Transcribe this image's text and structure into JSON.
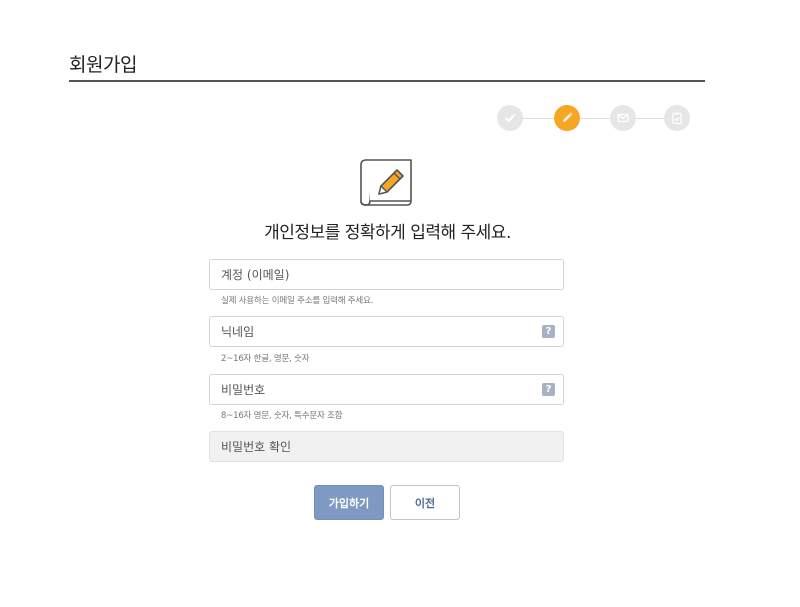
{
  "page": {
    "title": "회원가입",
    "heading": "개인정보를 정확하게 입력해 주세요."
  },
  "steps": [
    {
      "icon": "check-icon",
      "state": "done"
    },
    {
      "icon": "pencil-icon",
      "state": "active"
    },
    {
      "icon": "mail-icon",
      "state": "pending"
    },
    {
      "icon": "clipboard-icon",
      "state": "pending"
    }
  ],
  "form": {
    "email": {
      "placeholder": "계정 (이메일)",
      "hint": "실제 사용하는 이메일 주소를 입력해 주세요."
    },
    "nickname": {
      "placeholder": "닉네임",
      "hint": "2~16자 한글, 영문, 숫자",
      "help": "?"
    },
    "password": {
      "placeholder": "비밀번호",
      "hint": "8~16자 영문, 숫자, 특수문자 조합",
      "help": "?"
    },
    "password_confirm": {
      "placeholder": "비밀번호 확인"
    }
  },
  "buttons": {
    "submit_label": "가입하기",
    "back_label": "이전"
  },
  "colors": {
    "accent": "#f5a623",
    "primary_button": "#7f9ac2",
    "step_inactive": "#e6e6e6"
  }
}
